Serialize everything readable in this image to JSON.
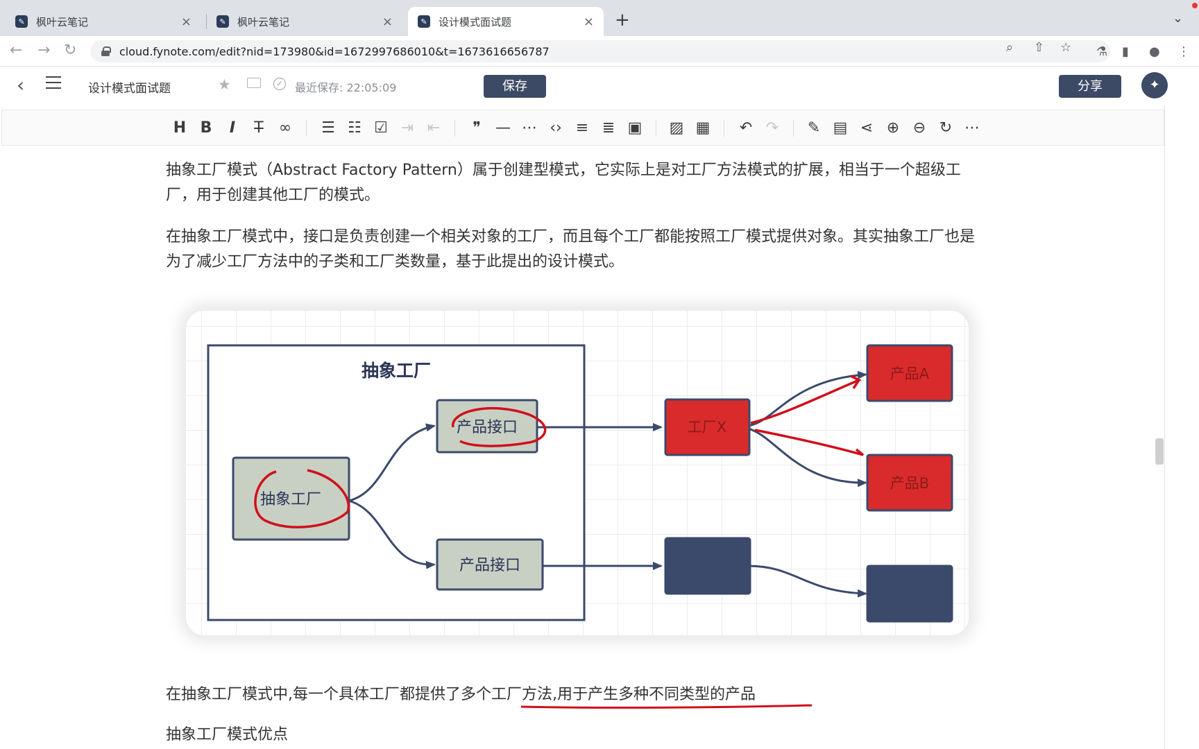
{
  "browser": {
    "tabs": [
      {
        "title": "枫叶云笔记",
        "active": false
      },
      {
        "title": "枫叶云笔记",
        "active": false
      },
      {
        "title": "设计模式面试题",
        "active": true
      }
    ],
    "url": "cloud.fynote.com/edit?nid=173980&id=1672997686010&t=1673616656787"
  },
  "header": {
    "doc_title": "设计模式面试题",
    "save_status": "最近保存: 22:05:09",
    "save_label": "保存",
    "share_label": "分享"
  },
  "toolbar": {
    "heading": "H",
    "bold": "B",
    "italic": "I"
  },
  "content": {
    "paragraph1": "抽象工厂模式（Abstract Factory Pattern）属于创建型模式，它实际上是对工厂方法模式的扩展，相当于一个超级工厂，用于创建其他工厂的模式。",
    "paragraph2": "在抽象工厂模式中，接口是负责创建一个相关对象的工厂，而且每个工厂都能按照工厂模式提供对象。其实抽象工厂也是为了减少工厂方法中的子类和工厂类数量，基于此提出的设计模式。",
    "paragraph3": "在抽象工厂模式中,每一个具体工厂都提供了多个工厂方法,用于产生多种不同类型的产品",
    "heading_advantages": "抽象工厂模式优点"
  },
  "diagram": {
    "group_title": "抽象工厂",
    "abstract_factory": "抽象工厂",
    "product_interface_1": "产品接口",
    "product_interface_2": "产品接口",
    "factory_x": "工厂X",
    "product_a": "产品A",
    "product_b": "产品B",
    "colors": {
      "gray_node": "#c8d0c4",
      "red_node": "#d92b2b",
      "navy": "#3b4a6b",
      "annotation": "#d0101b"
    }
  }
}
